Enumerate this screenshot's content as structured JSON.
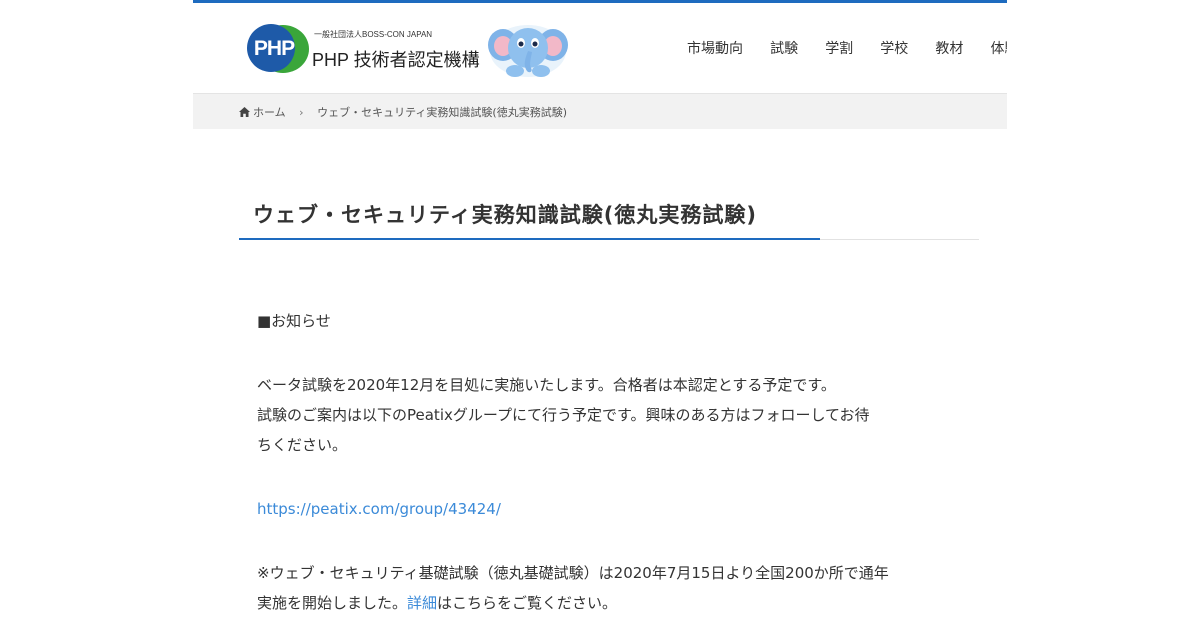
{
  "header": {
    "logo": {
      "mark": "PHP",
      "org_small": "一般社団法人BOSS-CON JAPAN",
      "org_main": "PHP 技術者認定機構"
    },
    "nav": [
      {
        "label": "市場動向"
      },
      {
        "label": "試験"
      },
      {
        "label": "学割"
      },
      {
        "label": "学校"
      },
      {
        "label": "教材"
      },
      {
        "label": "体験談"
      }
    ]
  },
  "breadcrumb": {
    "home": "ホーム",
    "current": "ウェブ・セキュリティ実務知識試験(徳丸実務試験)"
  },
  "page": {
    "title": "ウェブ・セキュリティ実務知識試験(徳丸実務試験)",
    "notice_heading": "■お知らせ",
    "para1_line1": "ベータ試験を2020年12月を目処に実施いたします。合格者は本認定とする予定です。",
    "para1_line2": "試験のご案内は以下のPeatixグループにて行う予定です。興味のある方はフォローしてお待",
    "para1_line3": "ちください。",
    "peatix_link": "https://peatix.com/group/43424/",
    "para2_line1": "※ウェブ・セキュリティ基礎試験（徳丸基礎試験）は2020年7月15日より全国200か所で通年",
    "para2_line2_before": "実施を開始しました。",
    "para2_detail_link": "詳細",
    "para2_line2_after": "はこちらをご覧ください。"
  },
  "colors": {
    "accent": "#1e6bbf",
    "link": "#3b8ad8",
    "breadcrumb_bg": "#f2f2f2"
  },
  "icons": {
    "breadcrumb_home": "home-icon",
    "breadcrumb_separator": "chevron-right-icon",
    "mascot": "elephant-mascot"
  }
}
